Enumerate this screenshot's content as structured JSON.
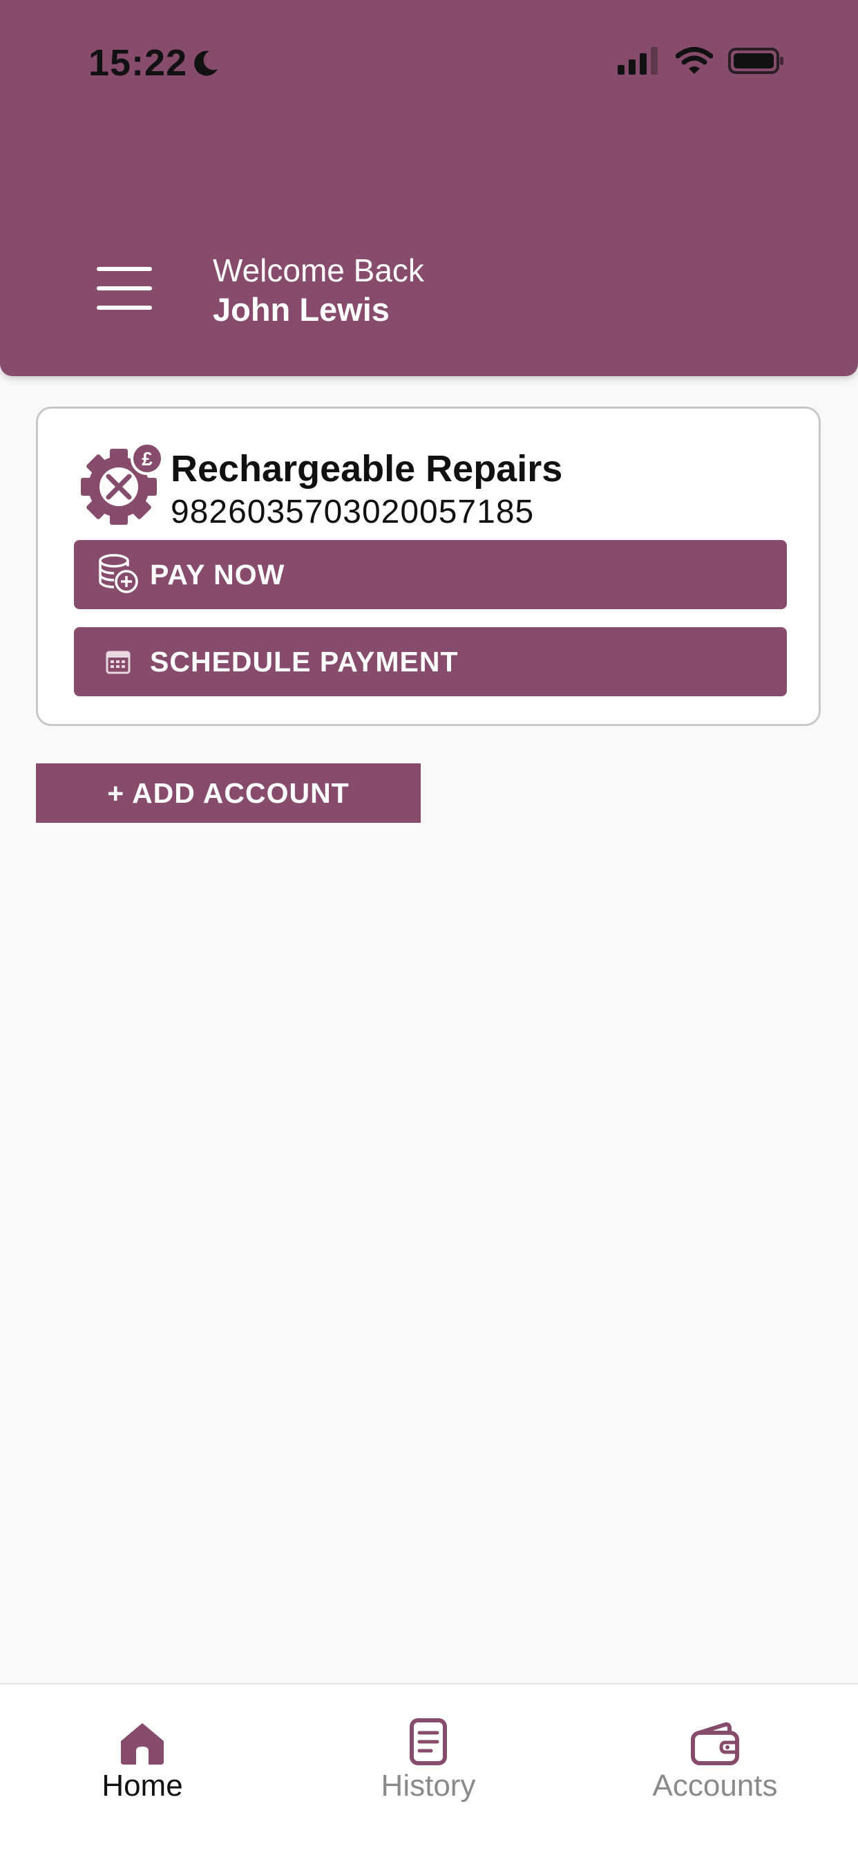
{
  "status_bar": {
    "time": "15:22"
  },
  "header": {
    "welcome_text": "Welcome Back",
    "user_name": "John Lewis"
  },
  "account_card": {
    "name": "Rechargeable Repairs",
    "number": "9826035703020057185",
    "icon": "repairs-gear-pound-icon",
    "pay_now_label": "PAY NOW",
    "schedule_label": "SCHEDULE PAYMENT"
  },
  "add_account_label": "+ ADD ACCOUNT",
  "tabs": [
    {
      "label": "Home",
      "icon": "home-icon",
      "active": true
    },
    {
      "label": "History",
      "icon": "history-icon",
      "active": false
    },
    {
      "label": "Accounts",
      "icon": "wallet-icon",
      "active": false
    }
  ],
  "colors": {
    "brand": "#874c6b",
    "background": "#f9f9f9",
    "inactive_tab": "#8a8a8a"
  }
}
